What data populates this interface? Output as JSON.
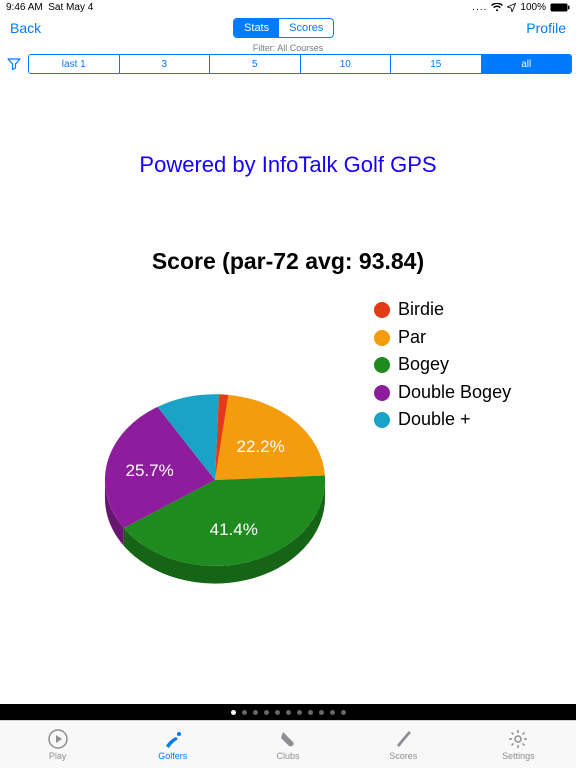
{
  "status": {
    "time": "9:46 AM",
    "date": "Sat May 4",
    "battery_pct": "100%"
  },
  "nav": {
    "back": "Back",
    "profile": "Profile",
    "seg": {
      "stats": "Stats",
      "scores": "Scores",
      "active": "stats"
    }
  },
  "filter": {
    "label": "Filter: All Courses",
    "options": [
      "last 1",
      "3",
      "5",
      "10",
      "15",
      "all"
    ],
    "active_index": 5
  },
  "powered_text": "Powered by InfoTalk Golf GPS",
  "score_title": "Score (par-72 avg: 93.84)",
  "chart_data": {
    "type": "pie",
    "title": "Score (par-72 avg: 93.84)",
    "series": [
      {
        "name": "Birdie",
        "value": 1.4,
        "color": "#e23b16",
        "show_label": false
      },
      {
        "name": "Par",
        "value": 22.2,
        "color": "#f59b0e",
        "show_label": true
      },
      {
        "name": "Bogey",
        "value": 41.4,
        "color": "#1f8b1f",
        "show_label": true
      },
      {
        "name": "Double Bogey",
        "value": 25.7,
        "color": "#8d1d9c",
        "show_label": true
      },
      {
        "name": "Double +",
        "value": 9.3,
        "color": "#19a3c6",
        "show_label": false
      }
    ],
    "legend_position": "right",
    "start_angle_deg": -88,
    "tilt": 0.78,
    "label_suffix": "%",
    "value_unit": "percent"
  },
  "pages": {
    "count": 11,
    "active": 0
  },
  "tabs": {
    "items": [
      {
        "id": "play",
        "label": "Play"
      },
      {
        "id": "golfers",
        "label": "Golfers"
      },
      {
        "id": "clubs",
        "label": "Clubs"
      },
      {
        "id": "scores",
        "label": "Scores"
      },
      {
        "id": "settings",
        "label": "Settings"
      }
    ],
    "active_index": 1
  },
  "colors": {
    "ios_blue": "#007aff",
    "inactive_gray": "#8e8e93"
  }
}
